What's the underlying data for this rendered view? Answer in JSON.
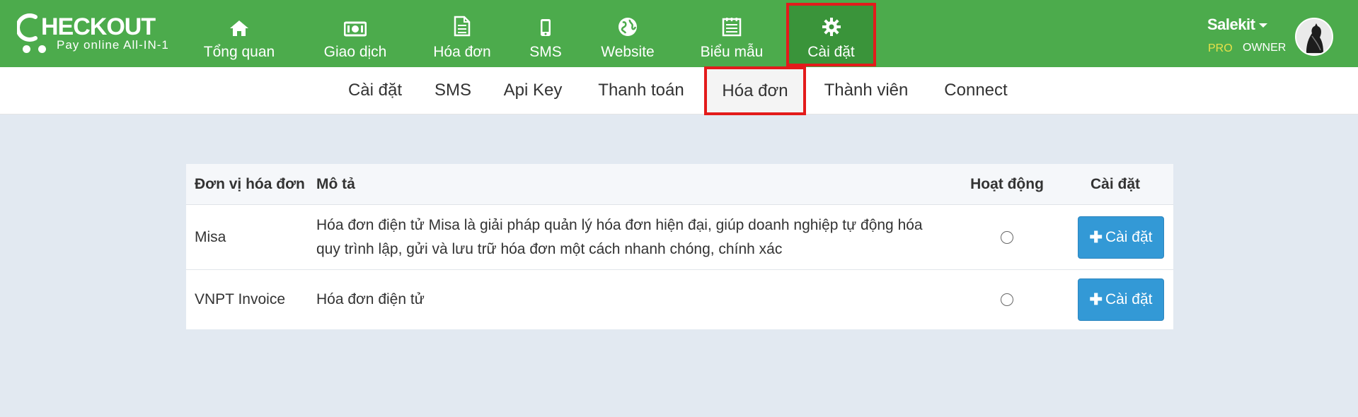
{
  "app": {
    "logo_main": "HECKOUT",
    "logo_sub": "Pay online All-IN-1"
  },
  "topnav": {
    "items": [
      {
        "label": "Tổng quan",
        "icon": "home-icon"
      },
      {
        "label": "Giao dịch",
        "icon": "money-icon"
      },
      {
        "label": "Hóa đơn",
        "icon": "invoice-icon"
      },
      {
        "label": "SMS",
        "icon": "phone-icon"
      },
      {
        "label": "Website",
        "icon": "globe-icon"
      },
      {
        "label": "Biểu mẫu",
        "icon": "form-icon"
      },
      {
        "label": "Cài đặt",
        "icon": "gear-icon"
      }
    ],
    "active": "Cài đặt"
  },
  "user": {
    "name": "Salekit",
    "plan": "PRO",
    "role": "OWNER"
  },
  "subnav": {
    "items": [
      "Cài đặt",
      "SMS",
      "Api Key",
      "Thanh toán",
      "Hóa đơn",
      "Thành viên",
      "Connect"
    ],
    "active": "Hóa đơn"
  },
  "table": {
    "headers": [
      "Đơn vị hóa đơn",
      "Mô tả",
      "Hoạt động",
      "Cài đặt"
    ],
    "rows": [
      {
        "provider": "Misa",
        "description_line1": "Hóa đơn điện tử Misa là giải pháp quản lý hóa đơn hiện đại, giúp doanh nghiệp tự động hóa",
        "description_line2": "quy trình lập, gửi và lưu trữ hóa đơn một cách nhanh chóng, chính xác",
        "active": false,
        "button_label": "Cài đặt"
      },
      {
        "provider": "VNPT Invoice",
        "description_line1": "Hóa đơn điện tử",
        "description_line2": "",
        "active": false,
        "button_label": "Cài đặt"
      }
    ]
  },
  "colors": {
    "topbar": "#4cab4c",
    "active_nav": "#3a943a",
    "highlight_border": "#e31b1b",
    "button": "#3399d6",
    "page_bg": "#e2e9f1"
  }
}
